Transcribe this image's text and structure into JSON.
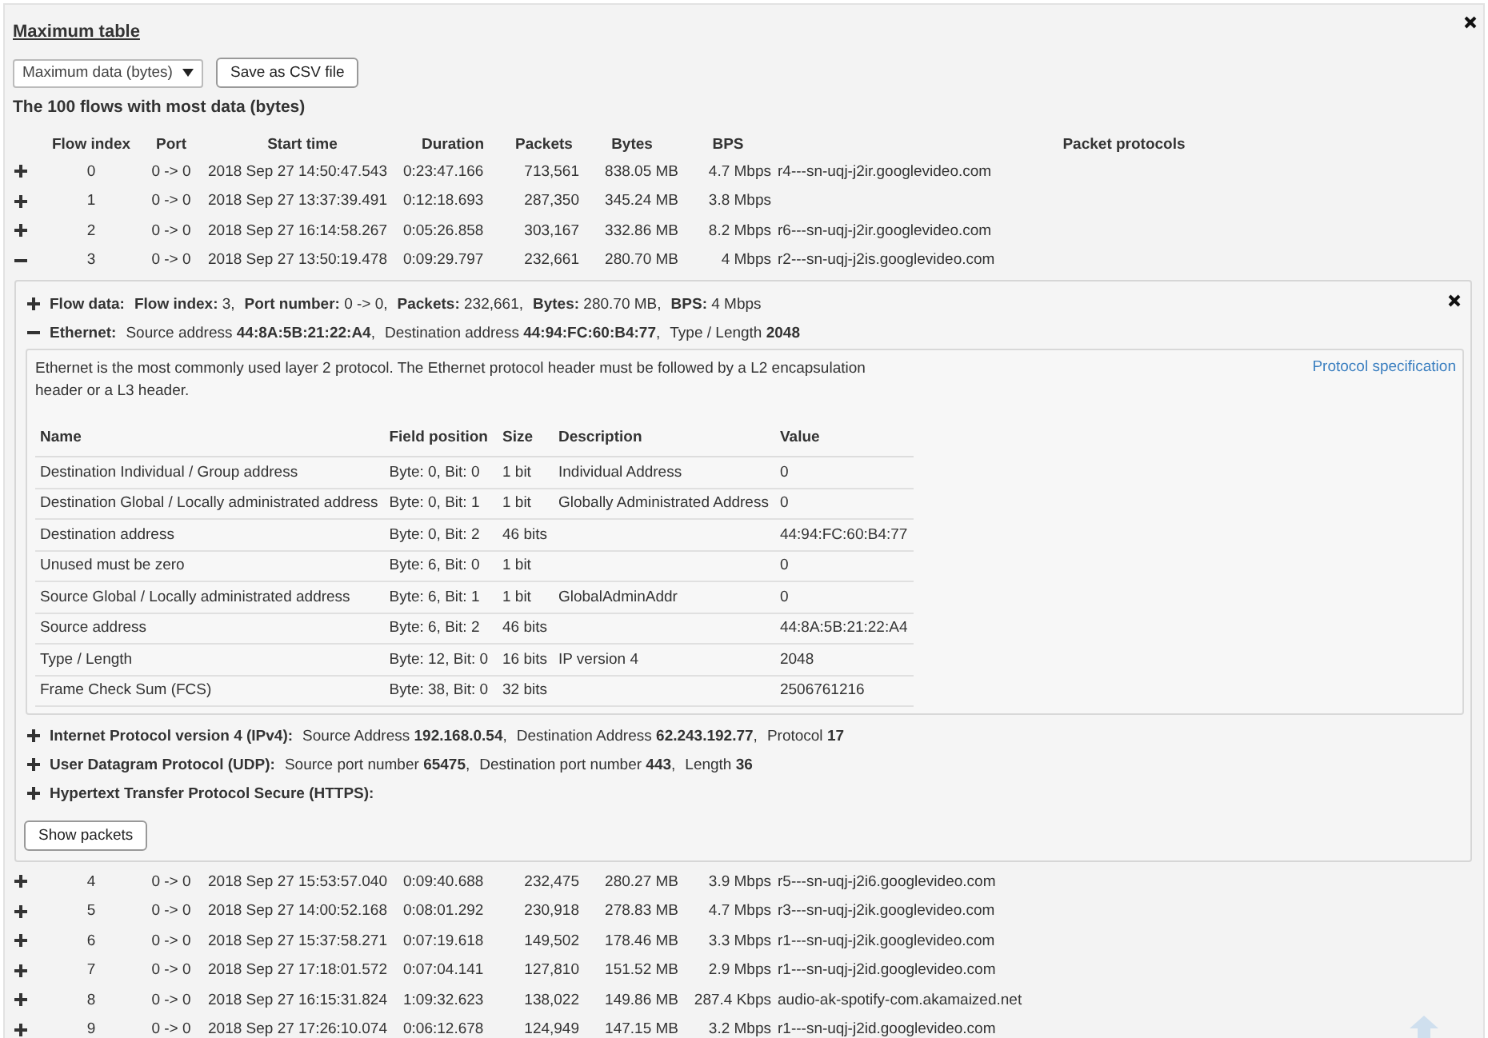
{
  "title": "Maximum table",
  "metric_select": {
    "value": "Maximum data (bytes)"
  },
  "csv_button": "Save as CSV file",
  "heading": "The 100 flows with most data (bytes)",
  "columns": [
    "Flow index",
    "Port",
    "Start time",
    "Duration",
    "Packets",
    "Bytes",
    "BPS",
    "Packet protocols"
  ],
  "flows": [
    {
      "expanded": false,
      "cells": [
        "0",
        "0 -> 0",
        "2018 Sep 27 14:50:47.543",
        "0:23:47.166",
        "713,561",
        "838.05 MB",
        "4.7 Mbps",
        "r4---sn-uqj-j2ir.googlevideo.com"
      ]
    },
    {
      "expanded": false,
      "cells": [
        "1",
        "0 -> 0",
        "2018 Sep 27 13:37:39.491",
        "0:12:18.693",
        "287,350",
        "345.24 MB",
        "3.8 Mbps",
        ""
      ]
    },
    {
      "expanded": false,
      "cells": [
        "2",
        "0 -> 0",
        "2018 Sep 27 16:14:58.267",
        "0:05:26.858",
        "303,167",
        "332.86 MB",
        "8.2 Mbps",
        "r6---sn-uqj-j2ir.googlevideo.com"
      ]
    },
    {
      "expanded": true,
      "cells": [
        "3",
        "0 -> 0",
        "2018 Sep 27 13:50:19.478",
        "0:09:29.797",
        "232,661",
        "280.70 MB",
        "4 Mbps",
        "r2---sn-uqj-j2is.googlevideo.com"
      ],
      "detail": {
        "layers": [
          {
            "title": "Flow data:",
            "expanded": false,
            "fields": [
              "**Flow index:** 3,",
              "**Port number:** 0 -> 0,",
              "**Packets:** 232,661,",
              "**Bytes:** 280.70 MB,",
              "**BPS:** 4 Mbps"
            ]
          },
          {
            "title": "Ethernet:",
            "expanded": true,
            "fields": [
              "Source address **44:8A:5B:21:22:A4**,",
              "Destination address **44:94:FC:60:B4:77**,",
              "Type / Length **2048**"
            ],
            "description": "Ethernet is the most commonly used layer 2 protocol. The Ethernet protocol header must be followed by a L2 encapsulation header or a L3 header.",
            "spec_link": "Protocol specification",
            "table": {
              "columns": [
                "Name",
                "Field position",
                "Size",
                "Description",
                "Value"
              ],
              "rows": [
                [
                  "Destination Individual / Group address",
                  "Byte: 0, Bit: 0",
                  "1 bit",
                  "Individual Address",
                  "0"
                ],
                [
                  "Destination Global / Locally administrated address",
                  "Byte: 0, Bit: 1",
                  "1 bit",
                  "Globally Administrated Address",
                  "0"
                ],
                [
                  "Destination address",
                  "Byte: 0, Bit: 2",
                  "46 bits",
                  "",
                  "44:94:FC:60:B4:77"
                ],
                [
                  "Unused must be zero",
                  "Byte: 6, Bit: 0",
                  "1 bit",
                  "",
                  "0"
                ],
                [
                  "Source Global / Locally administrated address",
                  "Byte: 6, Bit: 1",
                  "1 bit",
                  "GlobalAdminAddr",
                  "0"
                ],
                [
                  "Source address",
                  "Byte: 6, Bit: 2",
                  "46 bits",
                  "",
                  "44:8A:5B:21:22:A4"
                ],
                [
                  "Type / Length",
                  "Byte: 12, Bit: 0",
                  "16 bits",
                  "IP version 4",
                  "2048"
                ],
                [
                  "Frame Check Sum (FCS)",
                  "Byte: 38, Bit: 0",
                  "32 bits",
                  "",
                  "2506761216"
                ]
              ]
            }
          },
          {
            "title": "Internet Protocol version 4 (IPv4):",
            "expanded": false,
            "fields": [
              "Source Address **192.168.0.54**,",
              "Destination Address **62.243.192.77**,",
              "Protocol **17**"
            ]
          },
          {
            "title": "User Datagram Protocol (UDP):",
            "expanded": false,
            "fields": [
              "Source port number **65475**,",
              "Destination port number **443**,",
              "Length **36**"
            ]
          },
          {
            "title": "Hypertext Transfer Protocol Secure (HTTPS):",
            "expanded": false
          }
        ],
        "button": "Show packets"
      }
    },
    {
      "expanded": false,
      "cells": [
        "4",
        "0 -> 0",
        "2018 Sep 27 15:53:57.040",
        "0:09:40.688",
        "232,475",
        "280.27 MB",
        "3.9 Mbps",
        "r5---sn-uqj-j2i6.googlevideo.com"
      ]
    },
    {
      "expanded": false,
      "cells": [
        "5",
        "0 -> 0",
        "2018 Sep 27 14:00:52.168",
        "0:08:01.292",
        "230,918",
        "278.83 MB",
        "4.7 Mbps",
        "r3---sn-uqj-j2ik.googlevideo.com"
      ]
    },
    {
      "expanded": false,
      "cells": [
        "6",
        "0 -> 0",
        "2018 Sep 27 15:37:58.271",
        "0:07:19.618",
        "149,502",
        "178.46 MB",
        "3.3 Mbps",
        "r1---sn-uqj-j2ik.googlevideo.com"
      ]
    },
    {
      "expanded": false,
      "cells": [
        "7",
        "0 -> 0",
        "2018 Sep 27 17:18:01.572",
        "0:07:04.141",
        "127,810",
        "151.52 MB",
        "2.9 Mbps",
        "r1---sn-uqj-j2id.googlevideo.com"
      ]
    },
    {
      "expanded": false,
      "cells": [
        "8",
        "0 -> 0",
        "2018 Sep 27 16:15:31.824",
        "1:09:32.623",
        "138,022",
        "149.86 MB",
        "287.4 Kbps",
        "audio-ak-spotify-com.akamaized.net"
      ]
    },
    {
      "expanded": false,
      "cells": [
        "9",
        "0 -> 0",
        "2018 Sep 27 17:26:10.074",
        "0:06:12.678",
        "124,949",
        "147.15 MB",
        "3.2 Mbps",
        "r1---sn-uqj-j2id.googlevideo.com"
      ]
    }
  ]
}
